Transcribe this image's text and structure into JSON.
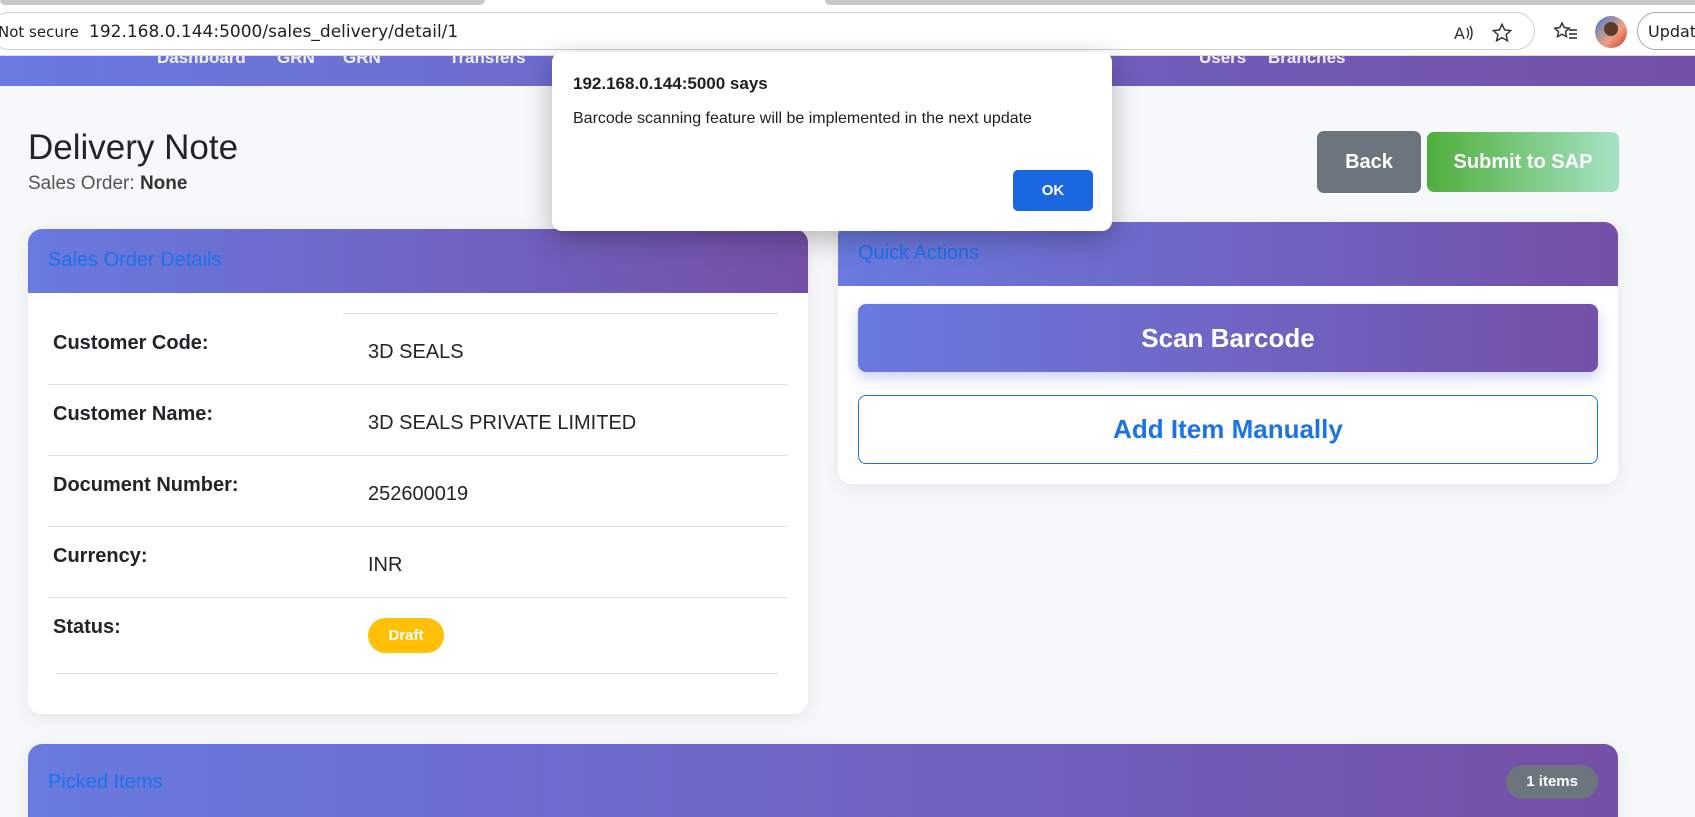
{
  "browser": {
    "security_label": "Not secure",
    "url": "192.168.0.144:5000/sales_delivery/detail/1",
    "update_label": "Update",
    "icons": [
      "read-aloud-icon",
      "favorite-star-icon",
      "favorites-list-icon",
      "profile-avatar"
    ]
  },
  "nav": {
    "links": [
      "Dashboard",
      "GRN",
      "GRN",
      "Transfers",
      "Users",
      "Branches"
    ]
  },
  "page": {
    "title": "Delivery Note",
    "subtitle_prefix": "Sales Order:",
    "subtitle_value": "None",
    "back_label": "Back",
    "submit_label": "Submit to SAP"
  },
  "details": {
    "header": "Sales Order Details",
    "rows": [
      {
        "label": "Customer Code:",
        "value": "3D SEALS"
      },
      {
        "label": "Customer Name:",
        "value": "3D SEALS PRIVATE LIMITED"
      },
      {
        "label": "Document Number:",
        "value": "252600019"
      },
      {
        "label": "Currency:",
        "value": "INR"
      },
      {
        "label": "Status:",
        "value": "Draft"
      }
    ]
  },
  "quick_actions": {
    "header": "Quick Actions",
    "scan_label": "Scan Barcode",
    "manual_label": "Add Item Manually"
  },
  "picked": {
    "header": "Picked Items",
    "count_label": "1 items"
  },
  "dialog": {
    "title": "192.168.0.144:5000 says",
    "message": "Barcode scanning feature will be implemented in the next update",
    "ok_label": "OK"
  },
  "colors": {
    "gradient_start": "#6a7ae0",
    "gradient_end": "#7450a8",
    "link_blue": "#1a73e8",
    "draft_badge": "#ffc107",
    "back_button": "#6c757d",
    "submit_start": "#4fae3c",
    "submit_end": "#a6e3c4"
  }
}
